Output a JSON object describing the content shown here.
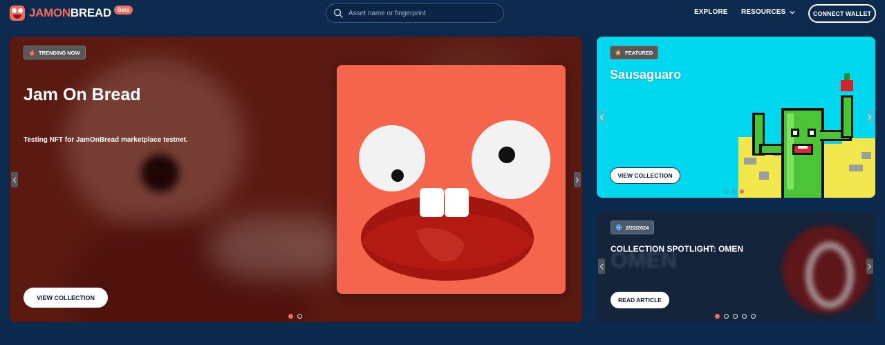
{
  "header": {
    "logo_part1": "JAMON",
    "logo_part2": "BREAD",
    "beta": "Beta",
    "search_placeholder": "Asset name or fingerprint",
    "nav": {
      "explore": "EXPLORE",
      "resources": "RESOURCES"
    },
    "connect_wallet": "CONNECT WALLET"
  },
  "hero": {
    "badge": "TRENDING NOW",
    "title": "Jam On Bread",
    "description": "Testing NFT for JamOnBread marketplace testnet.",
    "cta": "VIEW COLLECTION",
    "slides": 2,
    "active_slide": 1
  },
  "featured": {
    "badge": "FEATURED",
    "title": "Sausaguaro",
    "cta": "VIEW COLLECTION",
    "slides": 3,
    "active_slide": 3
  },
  "article": {
    "badge": "2/22/2024",
    "title": "COLLECTION SPOTLIGHT: OMEN",
    "background_text": "OMEN",
    "cta": "READ ARTICLE",
    "slides": 5,
    "active_slide": 1
  },
  "colors": {
    "background": "#0c2a4d",
    "accent": "#f26b5b",
    "featured_bg": "#00d8ef",
    "hero_art": "#f4654c"
  },
  "icons": [
    "search-icon",
    "fire-icon",
    "star-icon",
    "globe-icon",
    "chevron-down-icon",
    "chevron-left-icon",
    "chevron-right-icon"
  ]
}
